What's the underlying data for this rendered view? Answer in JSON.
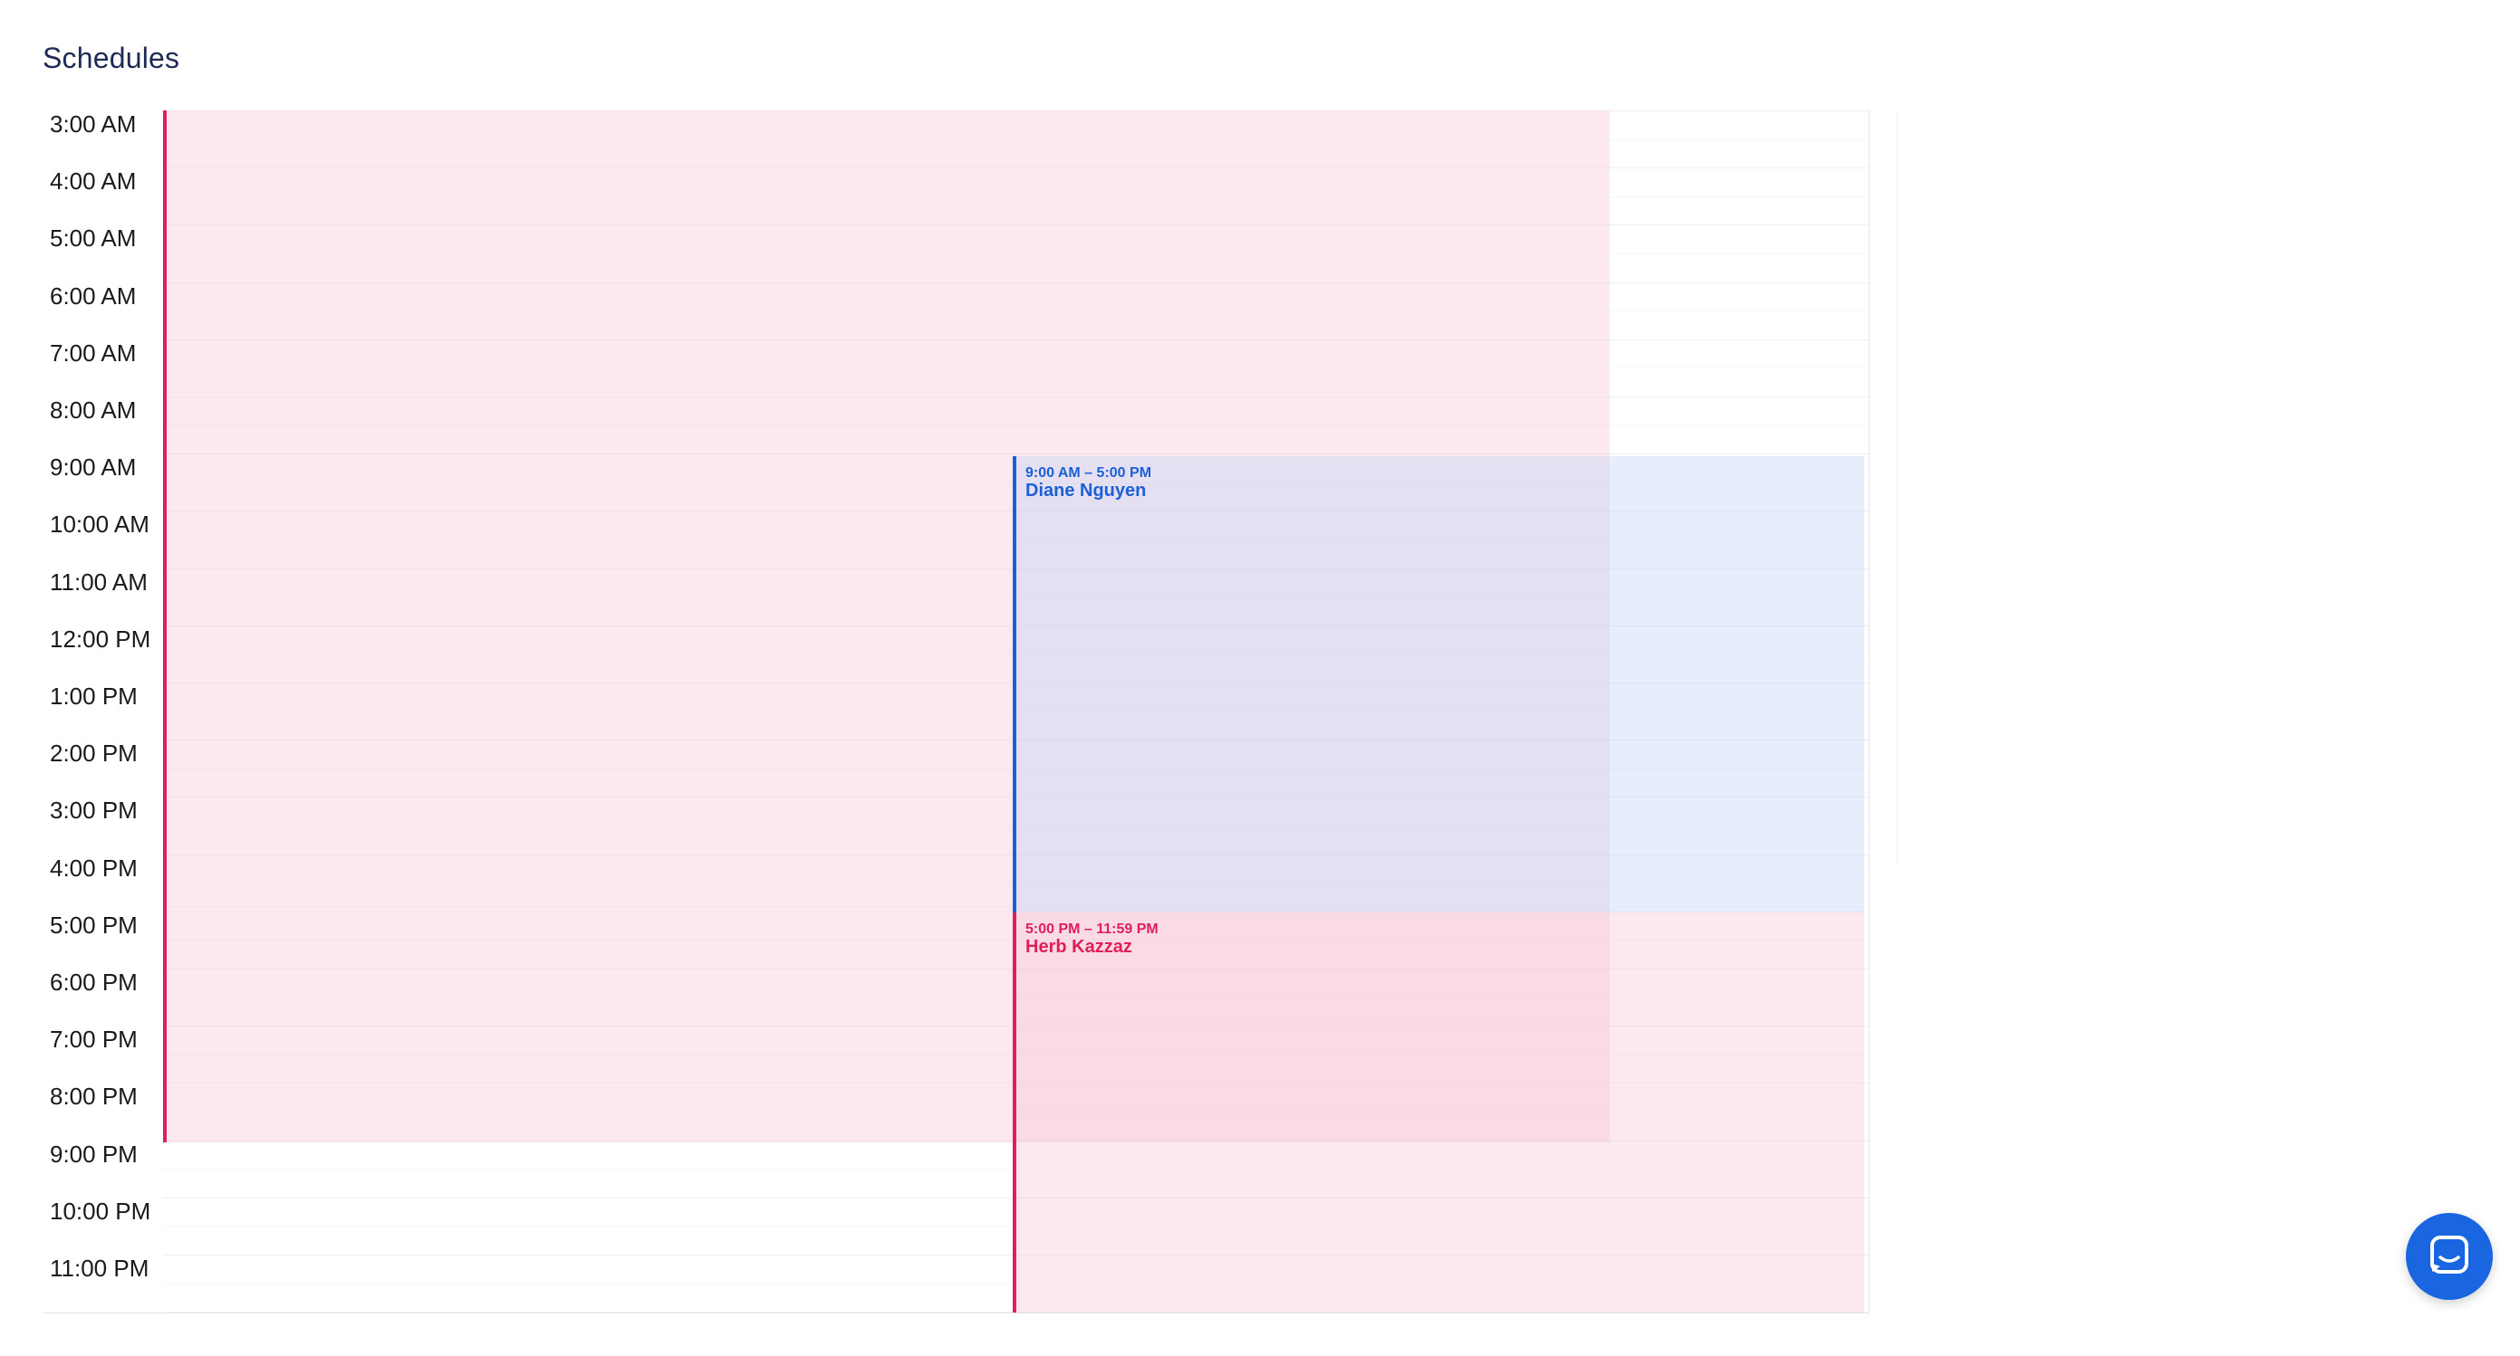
{
  "page": {
    "title": "Schedules"
  },
  "time_labels": [
    "3:00 AM",
    "4:00 AM",
    "5:00 AM",
    "6:00 AM",
    "7:00 AM",
    "8:00 AM",
    "9:00 AM",
    "10:00 AM",
    "11:00 AM",
    "12:00 PM",
    "1:00 PM",
    "2:00 PM",
    "3:00 PM",
    "4:00 PM",
    "5:00 PM",
    "6:00 PM",
    "7:00 PM",
    "8:00 PM",
    "9:00 PM",
    "10:00 PM",
    "11:00 PM"
  ],
  "events": [
    {
      "time": "",
      "name": "",
      "color": "#e01e5a"
    },
    {
      "time": "9:00 AM – 5:00 PM",
      "name": "Diane Nguyen",
      "color": "#1d5fd6"
    },
    {
      "time": "5:00 PM – 11:59 PM",
      "name": "Herb Kazzaz",
      "color": "#e01e5a"
    }
  ],
  "icons": {
    "chat_launcher": "chat-icon"
  },
  "colors": {
    "accent_pink": "#e01e5a",
    "accent_blue": "#1d5fd6",
    "launcher": "#1a66e0",
    "title": "#1f2a56"
  }
}
